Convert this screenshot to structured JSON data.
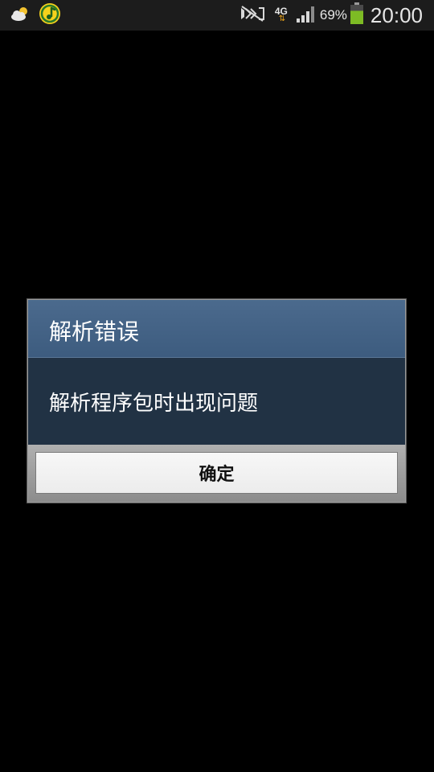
{
  "status_bar": {
    "icons_left": [
      "weather-cloudy-sun-icon",
      "music-app-icon"
    ],
    "network_type": "4G",
    "network_activity": "⇅",
    "icons_right": [
      "notifications-muted-icon",
      "signal-strength-icon",
      "battery-icon"
    ],
    "battery_percent": "69%",
    "battery_level": 0.69,
    "time": "20:00"
  },
  "dialog": {
    "title": "解析错误",
    "message": "解析程序包时出现问题",
    "ok_label": "确定"
  },
  "colors": {
    "title_bg": "#46658a",
    "body_bg": "#213244",
    "footer_bg": "#9a9a9a",
    "battery_green": "#7dbb24",
    "accent_orange": "#e8a21a"
  }
}
